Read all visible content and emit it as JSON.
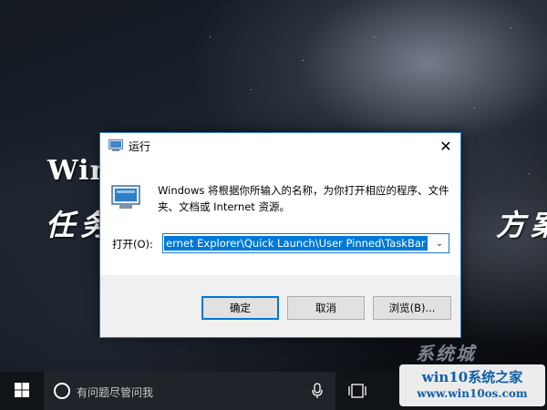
{
  "wallpaper": {
    "title": "Win",
    "subtitle_left": "任务",
    "subtitle_right": "方案"
  },
  "dialog": {
    "title": "运行",
    "close_glyph": "✕",
    "description": "Windows 将根据你所输入的名称，为你打开相应的程序、文件夹、文档或 Internet 资源。",
    "open_label": "打开(O):",
    "open_value": "ernet Explorer\\Quick Launch\\User Pinned\\TaskBar",
    "dropdown_glyph": "⌄",
    "buttons": {
      "ok": "确定",
      "cancel": "取消",
      "browse": "浏览(B)..."
    },
    "accent_color": "#0078d7"
  },
  "taskbar": {
    "search_placeholder": "有问题尽管问我",
    "icons": [
      "windows-start-icon",
      "cortana-icon",
      "microphone-icon",
      "task-view-icon"
    ]
  },
  "watermark": {
    "logo_text": "系统城",
    "site_name": "win10系统之家",
    "site_url": "www.win10os.com"
  }
}
